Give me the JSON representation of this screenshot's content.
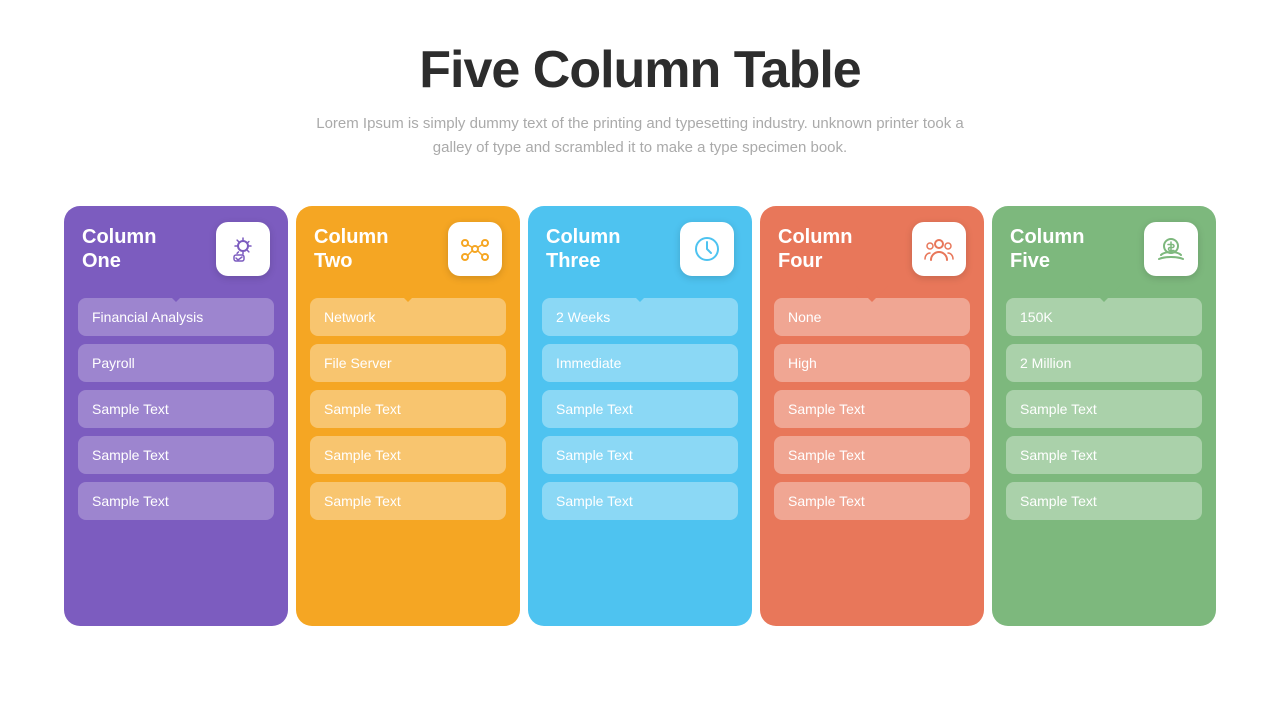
{
  "header": {
    "title": "Five Column Table",
    "subtitle": "Lorem Ipsum is simply dummy text of the printing and typesetting industry. unknown printer took a galley of type and scrambled it to make a type specimen book."
  },
  "columns": [
    {
      "id": "col-one",
      "title_line1": "Column",
      "title_line2": "One",
      "color": "#7c5cbf",
      "icon": "gear-check",
      "rows": [
        "Financial Analysis",
        "Payroll",
        "Sample Text",
        "Sample Text",
        "Sample Text"
      ]
    },
    {
      "id": "col-two",
      "title_line1": "Column",
      "title_line2": "Two",
      "color": "#f5a623",
      "icon": "network",
      "rows": [
        "Network",
        "File Server",
        "Sample Text",
        "Sample Text",
        "Sample Text"
      ]
    },
    {
      "id": "col-three",
      "title_line1": "Column",
      "title_line2": "Three",
      "color": "#4ec3f0",
      "icon": "clock",
      "rows": [
        "2 Weeks",
        "Immediate",
        "Sample Text",
        "Sample Text",
        "Sample Text"
      ]
    },
    {
      "id": "col-four",
      "title_line1": "Column",
      "title_line2": "Four",
      "color": "#e8775a",
      "icon": "people",
      "rows": [
        "None",
        "High",
        "Sample Text",
        "Sample Text",
        "Sample Text"
      ]
    },
    {
      "id": "col-five",
      "title_line1": "Column",
      "title_line2": "Five",
      "color": "#7db87d",
      "icon": "money",
      "rows": [
        "150K",
        "2 Million",
        "Sample Text",
        "Sample Text",
        "Sample Text"
      ]
    }
  ]
}
